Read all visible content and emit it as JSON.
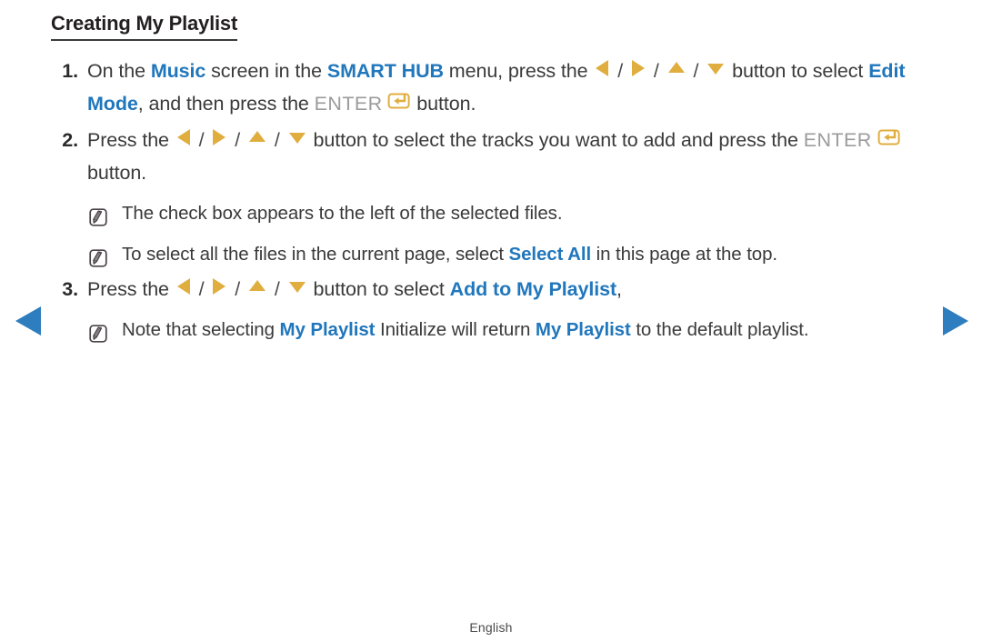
{
  "document": {
    "title": "Creating My Playlist",
    "footer_language": "English"
  },
  "navigation": {
    "prev_label": "previous page",
    "next_label": "next page",
    "prev_icon": "triangle-left-icon",
    "next_icon": "triangle-right-icon",
    "arrow_color": "#2e7dbe"
  },
  "colors": {
    "highlight_blue": "#2177bc",
    "key_gold": "#e0ae3f",
    "enter_gray": "#9b9b9b",
    "body_text": "#3a3a3a",
    "title_text": "#231f20"
  },
  "steps": [
    {
      "number": "1.",
      "segments": [
        {
          "type": "text",
          "value": "On the "
        },
        {
          "type": "highlight",
          "value": "Music"
        },
        {
          "type": "text",
          "value": " screen in the "
        },
        {
          "type": "highlight",
          "value": "SMART HUB"
        },
        {
          "type": "text",
          "value": " menu, press the "
        },
        {
          "type": "key-left",
          "value": "left-arrow-key-icon"
        },
        {
          "type": "sep",
          "value": "/"
        },
        {
          "type": "key-right",
          "value": "right-arrow-key-icon"
        },
        {
          "type": "sep",
          "value": "/"
        },
        {
          "type": "key-up",
          "value": "up-arrow-key-icon"
        },
        {
          "type": "sep",
          "value": "/"
        },
        {
          "type": "key-down",
          "value": "down-arrow-key-icon"
        },
        {
          "type": "text",
          "value": " button to select "
        },
        {
          "type": "highlight",
          "value": "Edit Mode"
        },
        {
          "type": "text",
          "value": ", and then press the "
        },
        {
          "type": "enter-word",
          "value": "ENTER"
        },
        {
          "type": "key-enter",
          "value": "enter-key-icon"
        },
        {
          "type": "text",
          "value": " button."
        }
      ]
    },
    {
      "number": "2.",
      "segments": [
        {
          "type": "text",
          "value": "Press the "
        },
        {
          "type": "key-left",
          "value": "left-arrow-key-icon"
        },
        {
          "type": "sep",
          "value": "/"
        },
        {
          "type": "key-right",
          "value": "right-arrow-key-icon"
        },
        {
          "type": "sep",
          "value": "/"
        },
        {
          "type": "key-up",
          "value": "up-arrow-key-icon"
        },
        {
          "type": "sep",
          "value": "/"
        },
        {
          "type": "key-down",
          "value": "down-arrow-key-icon"
        },
        {
          "type": "text",
          "value": " button to select the tracks you want to add and press the "
        },
        {
          "type": "enter-word",
          "value": "ENTER"
        },
        {
          "type": "key-enter",
          "value": "enter-key-icon"
        },
        {
          "type": "text",
          "value": " button."
        }
      ],
      "notes": [
        {
          "icon": "note-pencil-icon",
          "segments": [
            {
              "type": "text",
              "value": "The check box appears to the left of the selected files."
            }
          ]
        },
        {
          "icon": "note-pencil-icon",
          "segments": [
            {
              "type": "text",
              "value": "To select all the files in the current page, select "
            },
            {
              "type": "highlight",
              "value": "Select All"
            },
            {
              "type": "text",
              "value": " in this page at the top."
            }
          ]
        }
      ]
    },
    {
      "number": "3.",
      "segments": [
        {
          "type": "text",
          "value": "Press the "
        },
        {
          "type": "key-left",
          "value": "left-arrow-key-icon"
        },
        {
          "type": "sep",
          "value": "/"
        },
        {
          "type": "key-right",
          "value": "right-arrow-key-icon"
        },
        {
          "type": "sep",
          "value": "/"
        },
        {
          "type": "key-up",
          "value": "up-arrow-key-icon"
        },
        {
          "type": "sep",
          "value": "/"
        },
        {
          "type": "key-down",
          "value": "down-arrow-key-icon"
        },
        {
          "type": "text",
          "value": " button to select "
        },
        {
          "type": "highlight",
          "value": "Add to My Playlist"
        },
        {
          "type": "text",
          "value": ","
        }
      ],
      "notes": [
        {
          "icon": "note-pencil-icon",
          "segments": [
            {
              "type": "text",
              "value": "Note that selecting "
            },
            {
              "type": "highlight",
              "value": "My Playlist"
            },
            {
              "type": "text",
              "value": " Initialize will return "
            },
            {
              "type": "highlight",
              "value": "My Playlist"
            },
            {
              "type": "text",
              "value": " to the default playlist."
            }
          ]
        }
      ]
    }
  ]
}
